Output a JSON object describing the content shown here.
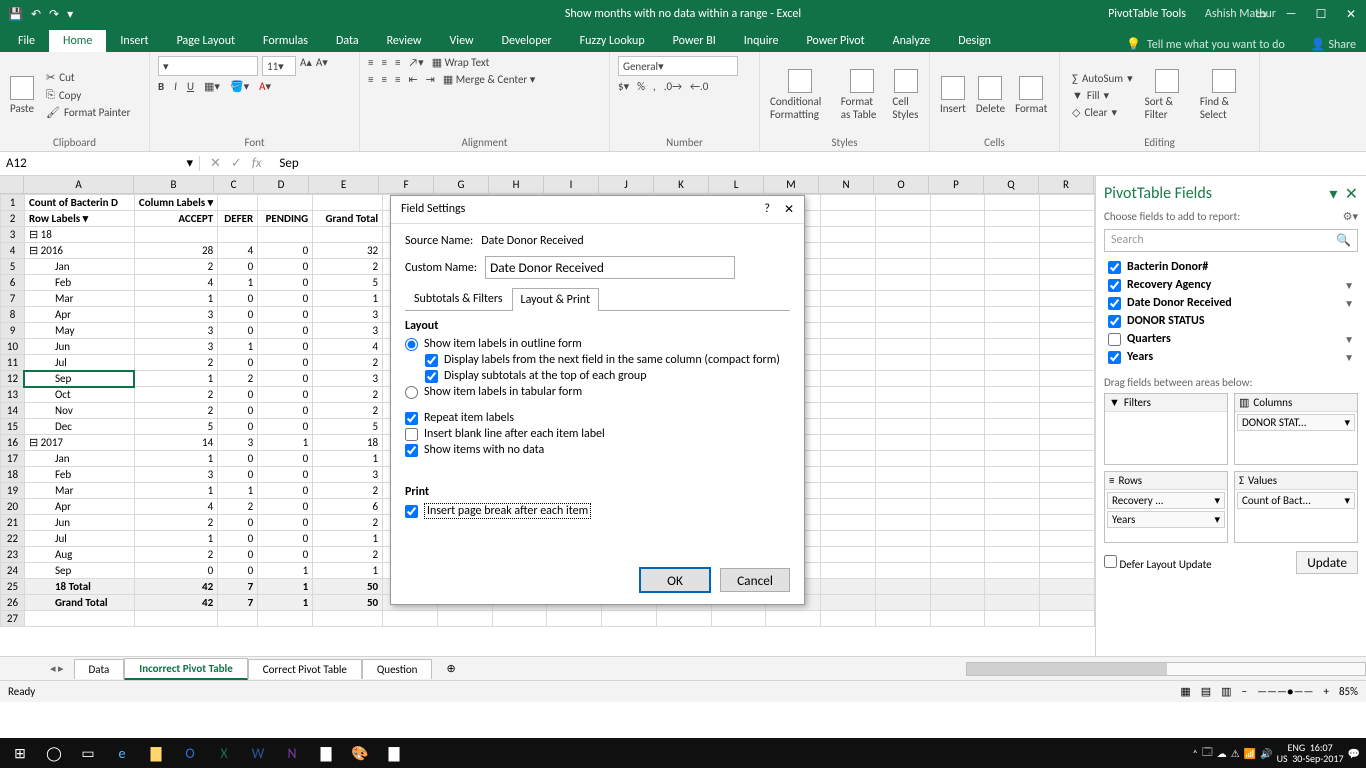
{
  "window": {
    "title": "Show months with no data within a range - Excel",
    "tool_context": "PivotTable Tools",
    "user": "Ashish Mathur"
  },
  "ribbon_tabs": [
    "File",
    "Home",
    "Insert",
    "Page Layout",
    "Formulas",
    "Data",
    "Review",
    "View",
    "Developer",
    "Fuzzy Lookup",
    "Power BI",
    "Inquire",
    "Power Pivot",
    "Analyze",
    "Design"
  ],
  "tellme": "Tell me what you want to do",
  "share": "Share",
  "clipboard": {
    "paste": "Paste",
    "cut": "Cut",
    "copy": "Copy",
    "painter": "Format Painter",
    "label": "Clipboard"
  },
  "font": {
    "size": "11",
    "label": "Font"
  },
  "alignment": {
    "wrap": "Wrap Text",
    "merge": "Merge & Center",
    "label": "Alignment"
  },
  "number": {
    "format": "General",
    "label": "Number"
  },
  "styles": {
    "cond": "Conditional Formatting",
    "fat": "Format as Table",
    "cell": "Cell Styles",
    "label": "Styles"
  },
  "cells": {
    "insert": "Insert",
    "delete": "Delete",
    "format": "Format",
    "label": "Cells"
  },
  "editing": {
    "autosum": "AutoSum",
    "fill": "Fill",
    "clear": "Clear",
    "sort": "Sort & Filter",
    "find": "Find & Select",
    "label": "Editing"
  },
  "namebox": "A12",
  "formula": "Sep",
  "columns_letters": [
    "A",
    "B",
    "C",
    "D",
    "E",
    "F",
    "G",
    "H",
    "I",
    "J",
    "K",
    "L",
    "M",
    "N",
    "O",
    "P",
    "Q",
    "R"
  ],
  "pivot": {
    "r1": {
      "a": "Count of Bacterin D",
      "b": "Column Labels"
    },
    "r2": {
      "a": "Row Labels",
      "b": "ACCEPT",
      "c": "DEFER",
      "d": "PENDING",
      "e": "Grand Total"
    },
    "rows": [
      {
        "n": 3,
        "a": "⊟ 18"
      },
      {
        "n": 4,
        "a": "⊟ 2016",
        "b": "28",
        "c": "4",
        "d": "0",
        "e": "32"
      },
      {
        "n": 5,
        "a": "Jan",
        "b": "2",
        "c": "0",
        "d": "0",
        "e": "2"
      },
      {
        "n": 6,
        "a": "Feb",
        "b": "4",
        "c": "1",
        "d": "0",
        "e": "5"
      },
      {
        "n": 7,
        "a": "Mar",
        "b": "1",
        "c": "0",
        "d": "0",
        "e": "1"
      },
      {
        "n": 8,
        "a": "Apr",
        "b": "3",
        "c": "0",
        "d": "0",
        "e": "3"
      },
      {
        "n": 9,
        "a": "May",
        "b": "3",
        "c": "0",
        "d": "0",
        "e": "3"
      },
      {
        "n": 10,
        "a": "Jun",
        "b": "3",
        "c": "1",
        "d": "0",
        "e": "4"
      },
      {
        "n": 11,
        "a": "Jul",
        "b": "2",
        "c": "0",
        "d": "0",
        "e": "2"
      },
      {
        "n": 12,
        "a": "Sep",
        "b": "1",
        "c": "2",
        "d": "0",
        "e": "3",
        "sel": true
      },
      {
        "n": 13,
        "a": "Oct",
        "b": "2",
        "c": "0",
        "d": "0",
        "e": "2"
      },
      {
        "n": 14,
        "a": "Nov",
        "b": "2",
        "c": "0",
        "d": "0",
        "e": "2"
      },
      {
        "n": 15,
        "a": "Dec",
        "b": "5",
        "c": "0",
        "d": "0",
        "e": "5"
      },
      {
        "n": 16,
        "a": "⊟ 2017",
        "b": "14",
        "c": "3",
        "d": "1",
        "e": "18"
      },
      {
        "n": 17,
        "a": "Jan",
        "b": "1",
        "c": "0",
        "d": "0",
        "e": "1"
      },
      {
        "n": 18,
        "a": "Feb",
        "b": "3",
        "c": "0",
        "d": "0",
        "e": "3"
      },
      {
        "n": 19,
        "a": "Mar",
        "b": "1",
        "c": "1",
        "d": "0",
        "e": "2"
      },
      {
        "n": 20,
        "a": "Apr",
        "b": "4",
        "c": "2",
        "d": "0",
        "e": "6"
      },
      {
        "n": 21,
        "a": "Jun",
        "b": "2",
        "c": "0",
        "d": "0",
        "e": "2"
      },
      {
        "n": 22,
        "a": "Jul",
        "b": "1",
        "c": "0",
        "d": "0",
        "e": "1"
      },
      {
        "n": 23,
        "a": "Aug",
        "b": "2",
        "c": "0",
        "d": "0",
        "e": "2"
      },
      {
        "n": 24,
        "a": "Sep",
        "b": "0",
        "c": "0",
        "d": "1",
        "e": "1"
      }
    ],
    "total18": {
      "n": 25,
      "a": "18 Total",
      "b": "42",
      "c": "7",
      "d": "1",
      "e": "50"
    },
    "grand": {
      "n": 26,
      "a": "Grand Total",
      "b": "42",
      "c": "7",
      "d": "1",
      "e": "50"
    }
  },
  "dialog": {
    "title": "Field Settings",
    "source_lbl": "Source Name:",
    "source_val": "Date Donor Received",
    "custom_lbl": "Custom Name:",
    "custom_val": "Date Donor Received",
    "tab1": "Subtotals & Filters",
    "tab2": "Layout & Print",
    "layout_title": "Layout",
    "opt_outline": "Show item labels in outline form",
    "opt_compact": "Display labels from the next field in the same column (compact form)",
    "opt_subtop": "Display subtotals at the top of each group",
    "opt_tabular": "Show item labels in tabular form",
    "opt_repeat": "Repeat item labels",
    "opt_blank": "Insert blank line after each item label",
    "opt_nodata": "Show items with no data",
    "print_title": "Print",
    "opt_pagebreak": "Insert page break after each item",
    "ok": "OK",
    "cancel": "Cancel"
  },
  "fieldpane": {
    "title": "PivotTable Fields",
    "sub": "Choose fields to add to report:",
    "search_ph": "Search",
    "fields": [
      {
        "name": "Bacterin Donor#",
        "checked": true,
        "filter": false
      },
      {
        "name": "Recovery Agency",
        "checked": true,
        "filter": true
      },
      {
        "name": "Date Donor Received",
        "checked": true,
        "filter": true
      },
      {
        "name": "DONOR STATUS",
        "checked": true,
        "filter": false
      },
      {
        "name": "Quarters",
        "checked": false,
        "filter": true
      },
      {
        "name": "Years",
        "checked": true,
        "filter": true
      }
    ],
    "drag_label": "Drag fields between areas below:",
    "filters_h": "Filters",
    "columns_h": "Columns",
    "rows_h": "Rows",
    "values_h": "Values",
    "col_item": "DONOR STAT...",
    "row_item1": "Recovery ...",
    "row_item2": "Years",
    "val_item": "Count of Bact...",
    "defer": "Defer Layout Update",
    "update": "Update"
  },
  "sheets": {
    "nav": "◂ ▸",
    "s1": "Data",
    "s2": "Incorrect Pivot Table",
    "s3": "Correct Pivot Table",
    "s4": "Question",
    "add": "⊕"
  },
  "status": {
    "ready": "Ready",
    "zoom": "85%"
  },
  "taskbar": {
    "lang": "ENG",
    "loc": "US",
    "time": "16:07",
    "date": "30-Sep-2017"
  }
}
